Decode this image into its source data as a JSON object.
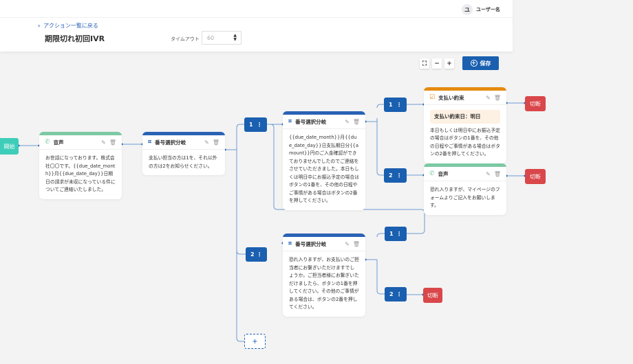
{
  "header": {
    "back_label": "アクション一覧に戻る",
    "title": "期限切れ初回IVR",
    "timeout_label": "タイムアウト",
    "timeout_value": "60",
    "user_initial": "ユ",
    "user_name": "ユーザー名"
  },
  "toolbar": {
    "fit_icon": "⛶",
    "zoom_out": "−",
    "zoom_in": "+",
    "save_label": "保存"
  },
  "colors": {
    "start": "#3ecdb8",
    "voice": "#7cc9a3",
    "branch": "#2a62b5",
    "payment": "#e58a10",
    "terminate": "#d9474a",
    "badge": "#1a5fb0"
  },
  "flow": {
    "start_label": "開始",
    "terminate_label": "切断",
    "add_label": "+",
    "nodes": [
      {
        "type": "音声",
        "icon": "phone-icon",
        "text": "お世話になっております。株式会社〇〇です。{{due_date_month}}月{{due_date_day}}日期日の請求が未収になっている件についてご連絡いたしました。"
      },
      {
        "type": "番号選択分岐",
        "icon": "dialpad-icon",
        "text": "支払い担当の方は1を、それ以外の方は2をお知らせください。"
      },
      {
        "type": "番号選択分岐",
        "icon": "dialpad-icon",
        "text": "{{due_date_month}}月{{due_date_day}}日支払期日分{{amount}}円のご入金確認ができておりませんでしたのでご連絡をさせていただきました。本日もしくは明日中にお振込予定の場合はボタンの1番を、その他の日程やご事情がある場合はボタンの2番を押してください。"
      },
      {
        "type": "支払い約束",
        "icon": "calendar-check-icon",
        "highlight": "支払い約束日：明日",
        "text": "本日もしくは明日中にお振込予定の場合はボタンの1番を、その他の日程やご事情がある場合はボタンの2番を押してください。"
      },
      {
        "type": "音声",
        "icon": "phone-icon",
        "text": "恐れ入りますが、マイページのフォームよりご記入をお願いします。"
      },
      {
        "type": "番号選択分岐",
        "icon": "dialpad-icon",
        "text": "恐れ入りますが、お支払いのご担当者にお繋ぎいただけますでしょうか。ご担当者様にお繋ぎいただけましたら、ボタンの1番を押してください。その他のご事情がある場合は、ボタンの2番を押してください。"
      }
    ],
    "badges": [
      "1",
      "2",
      "1",
      "2",
      "1",
      "2"
    ]
  }
}
